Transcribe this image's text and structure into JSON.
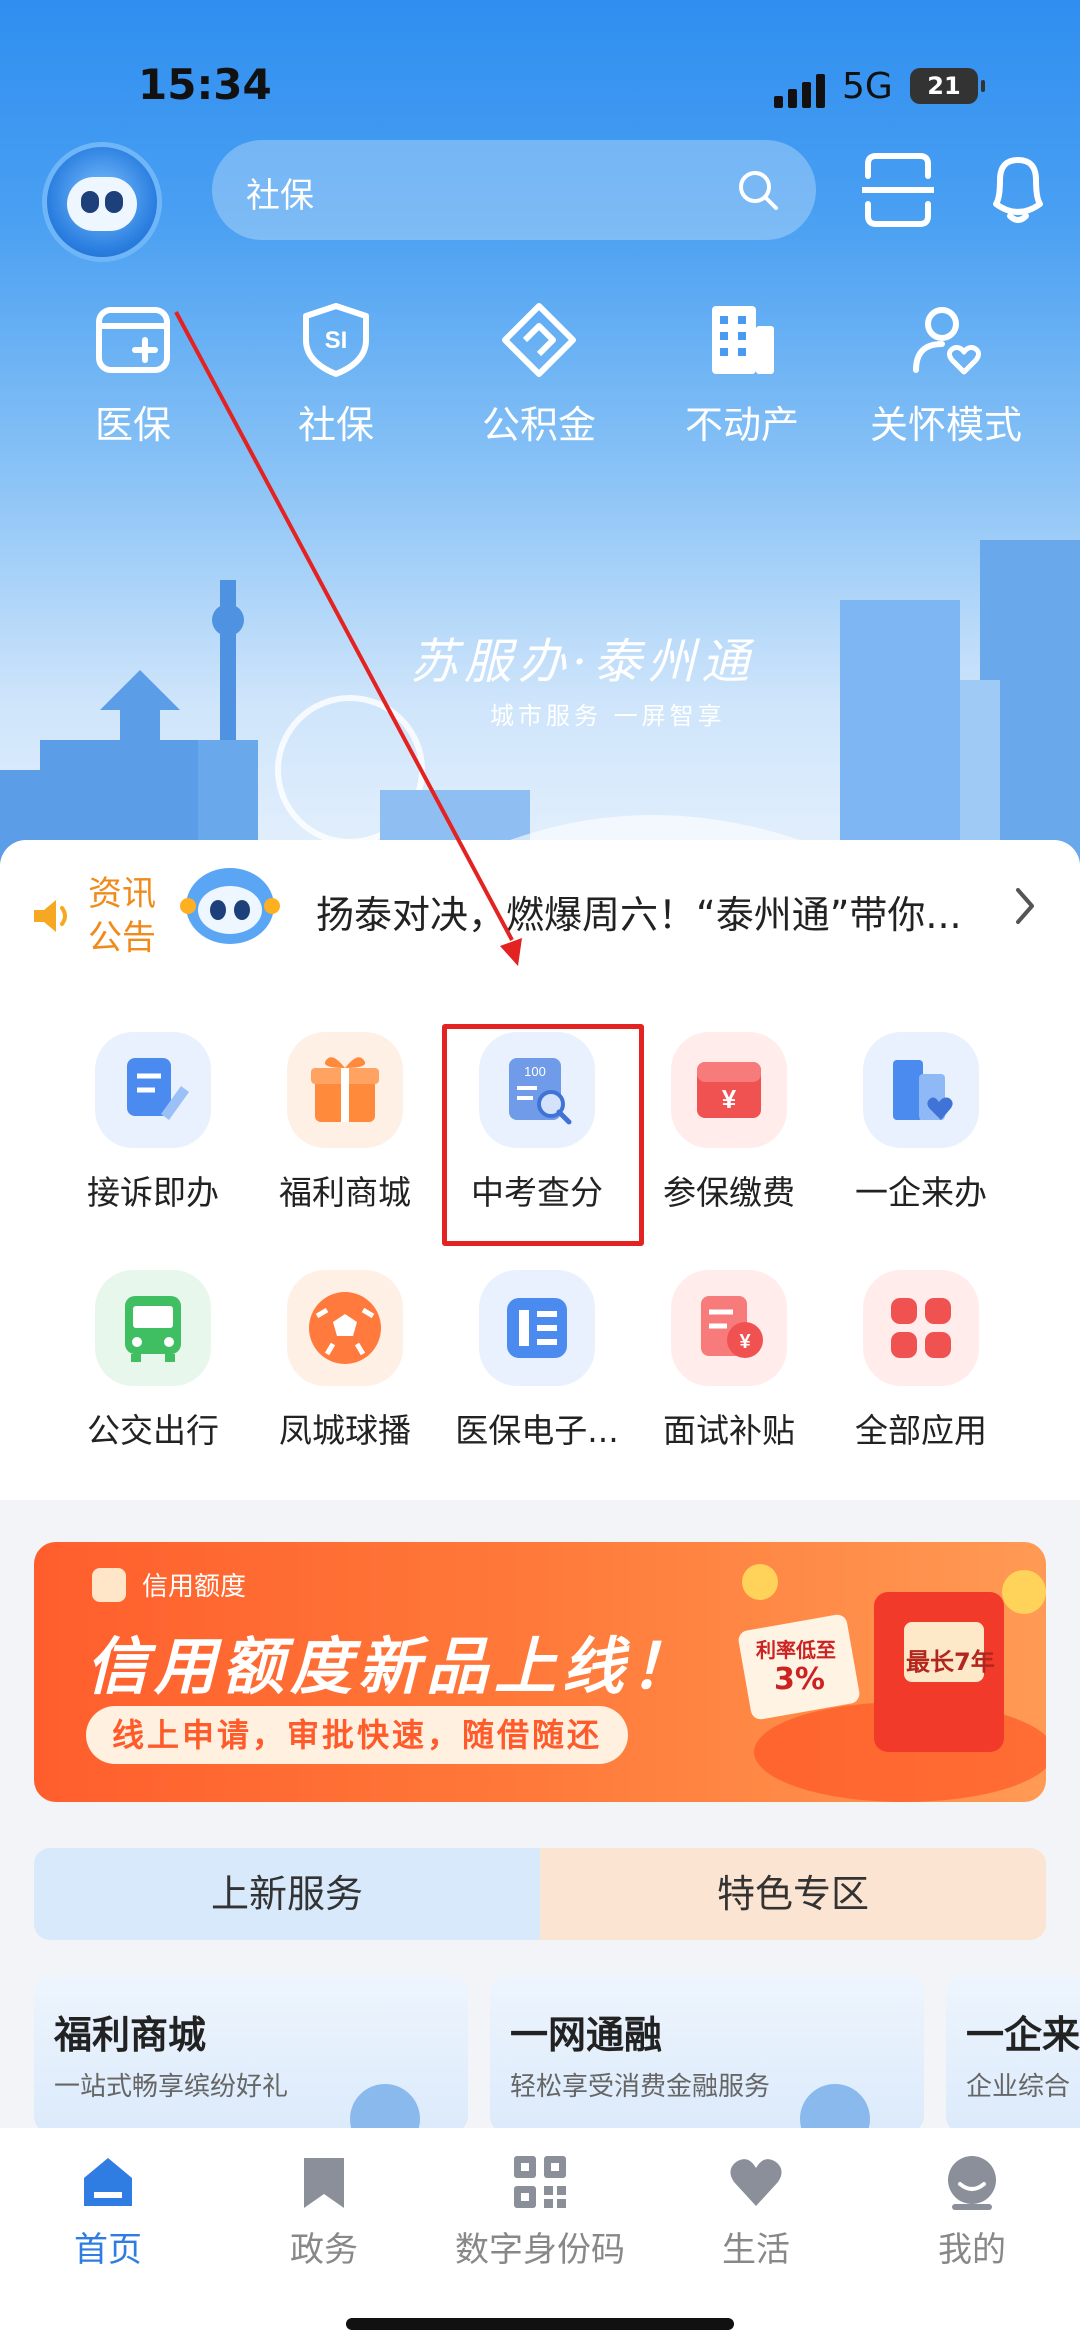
{
  "status": {
    "time": "15:34",
    "network": "5G",
    "battery": "21"
  },
  "search": {
    "placeholder": "社保"
  },
  "quick": [
    {
      "label": "医保",
      "icon": "card-plus-icon"
    },
    {
      "label": "社保",
      "icon": "si-shield-icon"
    },
    {
      "label": "公积金",
      "icon": "housing-fund-icon"
    },
    {
      "label": "不动产",
      "icon": "building-icon"
    },
    {
      "label": "关怀模式",
      "icon": "care-mode-icon"
    }
  ],
  "brand": {
    "name": "苏服办·泰州通",
    "slogan": "城市服务 一屏智享"
  },
  "news": {
    "label1": "资讯",
    "label2": "公告",
    "text": "扬泰对决，燃爆周六！“泰州通”带你..."
  },
  "apps": [
    {
      "label": "接诉即办",
      "icon": "complaint-form-icon",
      "color": "#4b8bf0"
    },
    {
      "label": "福利商城",
      "icon": "gift-icon",
      "color": "#ff8a3c"
    },
    {
      "label": "中考查分",
      "icon": "exam-score-icon",
      "color": "#5b8fe8"
    },
    {
      "label": "参保缴费",
      "icon": "payment-envelope-icon",
      "color": "#f05252"
    },
    {
      "label": "一企来办",
      "icon": "enterprise-icon",
      "color": "#4b8bf0"
    },
    {
      "label": "公交出行",
      "icon": "bus-icon",
      "color": "#3fbf62"
    },
    {
      "label": "凤城球播",
      "icon": "football-icon",
      "color": "#ff7a3c"
    },
    {
      "label": "医保电子...",
      "icon": "e-card-icon",
      "color": "#4b8bf0"
    },
    {
      "label": "面试补贴",
      "icon": "subsidy-icon",
      "color": "#f05252"
    },
    {
      "label": "全部应用",
      "icon": "all-apps-icon",
      "color": "#f05252"
    }
  ],
  "banner": {
    "tag": "信用额度",
    "title": "信用额度新品上线！",
    "subtitle": "线上申请，审批快速，随借随还",
    "badge1": "利率低至",
    "badge1_value": "3%",
    "badge2": "最长7年"
  },
  "tabs": {
    "new": "上新服务",
    "featured": "特色专区"
  },
  "cards": [
    {
      "title": "福利商城",
      "subtitle": "一站式畅享缤纷好礼"
    },
    {
      "title": "一网通融",
      "subtitle": "轻松享受消费金融服务"
    },
    {
      "title": "一企来",
      "subtitle": "企业综合"
    }
  ],
  "nav": [
    {
      "label": "首页",
      "icon": "home-icon"
    },
    {
      "label": "政务",
      "icon": "bookmark-icon"
    },
    {
      "label": "数字身份码",
      "icon": "qr-code-icon"
    },
    {
      "label": "生活",
      "icon": "heart-icon"
    },
    {
      "label": "我的",
      "icon": "profile-icon"
    }
  ],
  "colors": {
    "accent": "#2f7de3",
    "highlight": "#e32222"
  }
}
